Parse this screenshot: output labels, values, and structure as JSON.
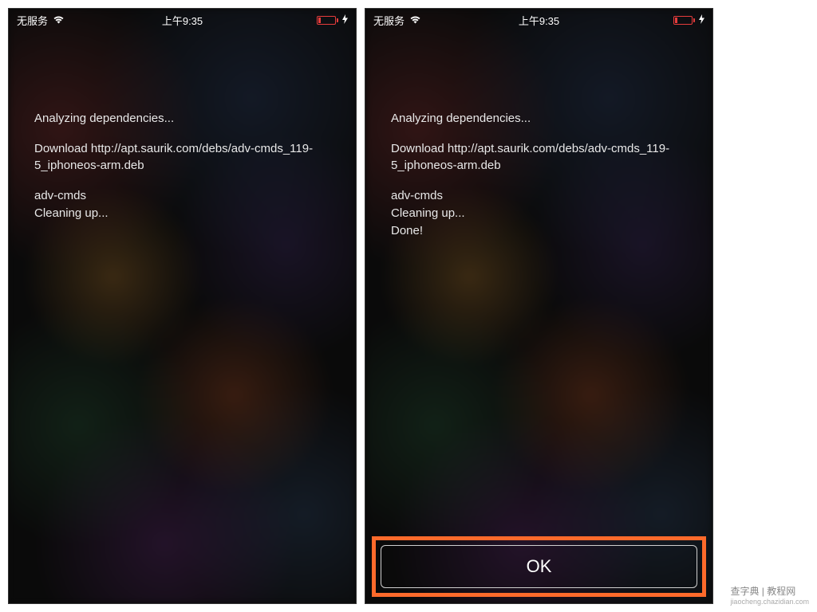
{
  "status_bar": {
    "carrier": "无服务",
    "time": "上午9:35"
  },
  "screen_left": {
    "lines": [
      "Analyzing dependencies...",
      "",
      "Download http://apt.saurik.com/debs/adv-cmds_119-5_iphoneos-arm.deb",
      "",
      "adv-cmds",
      "Cleaning up..."
    ]
  },
  "screen_right": {
    "lines": [
      "Analyzing dependencies...",
      "",
      "Download http://apt.saurik.com/debs/adv-cmds_119-5_iphoneos-arm.deb",
      "",
      "adv-cmds",
      "Cleaning up...",
      "Done!"
    ],
    "ok_button": "OK"
  },
  "watermark": {
    "main": "查字典 | 教程网",
    "sub": "jiaocheng.chazidian.com"
  },
  "colors": {
    "highlight_border": "#ff6a2b",
    "battery_low": "#e73c3c"
  }
}
